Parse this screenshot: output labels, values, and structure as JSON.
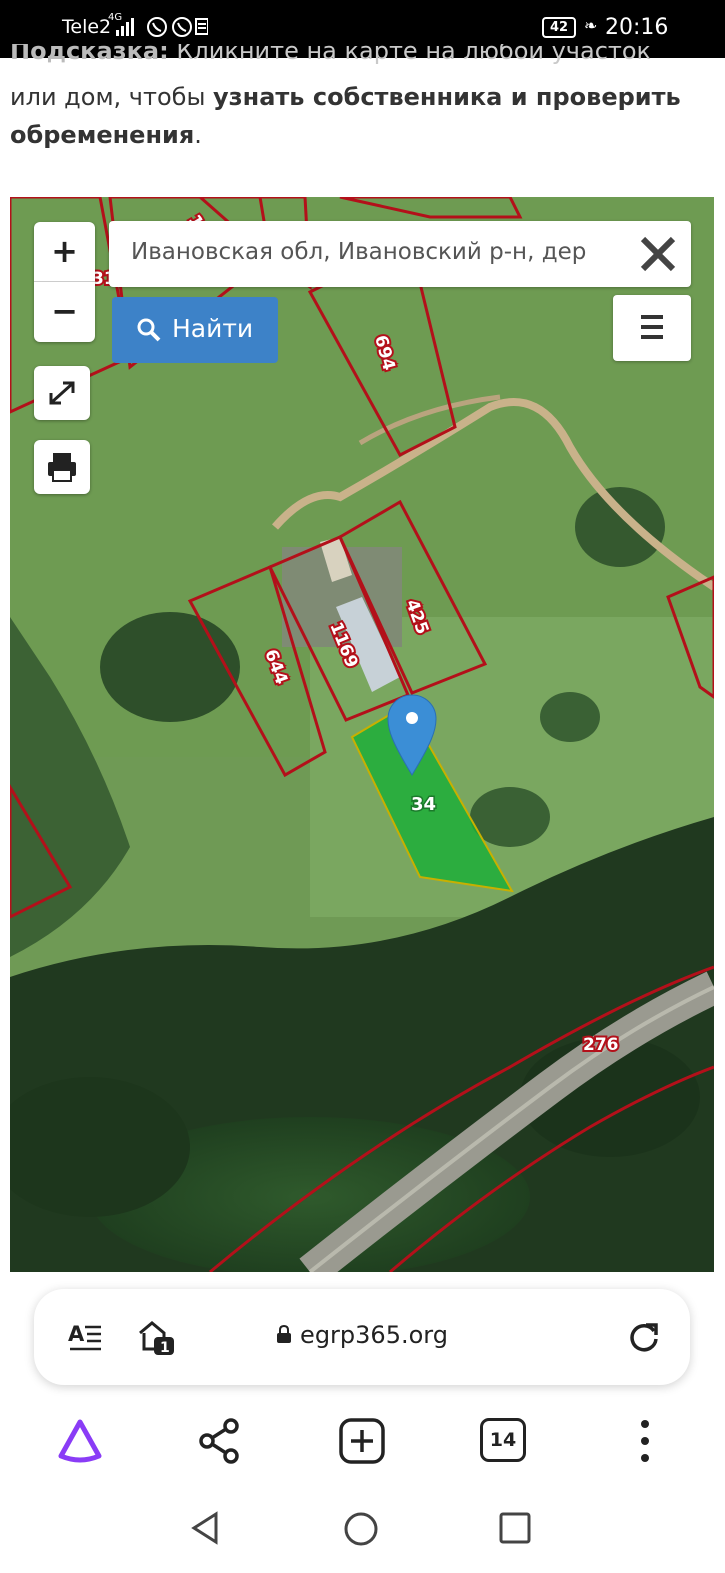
{
  "status_bar": {
    "carrier": "Tele2",
    "network": "4G",
    "battery": "42",
    "time": "20:16"
  },
  "hint": {
    "head_label": "Подсказка:",
    "head_text": "Кликните на карте на любой участок",
    "line2_plain": "или дом, чтобы ",
    "line2_bold": "узнать собственника и проверить обременения",
    "line2_tail": "."
  },
  "map": {
    "search_value": "Ивановская обл, Ивановский р-н, дер",
    "find_label": "Найти",
    "zoom_in_label": "+",
    "zoom_out_label": "−",
    "parcel_labels": [
      "694",
      "425",
      "1169",
      "644",
      "34",
      "276"
    ],
    "edge_labels": [
      "31",
      "1"
    ],
    "colors": {
      "parcel_border": "#b3101a",
      "selected_fill": "#1fae3a",
      "marker": "#3b8ed6",
      "find_button": "#3d82c8"
    }
  },
  "browser": {
    "url": "egrp365.org",
    "tab_count": "14",
    "home_badge": "1",
    "reader_icon": "reader-mode-icon",
    "toolbar_icons": [
      "alice-assistant-icon",
      "share-icon",
      "new-tab-icon",
      "tabs-icon",
      "more-icon"
    ]
  },
  "nav": {
    "icons": [
      "back-icon",
      "home-icon",
      "recents-icon"
    ]
  }
}
